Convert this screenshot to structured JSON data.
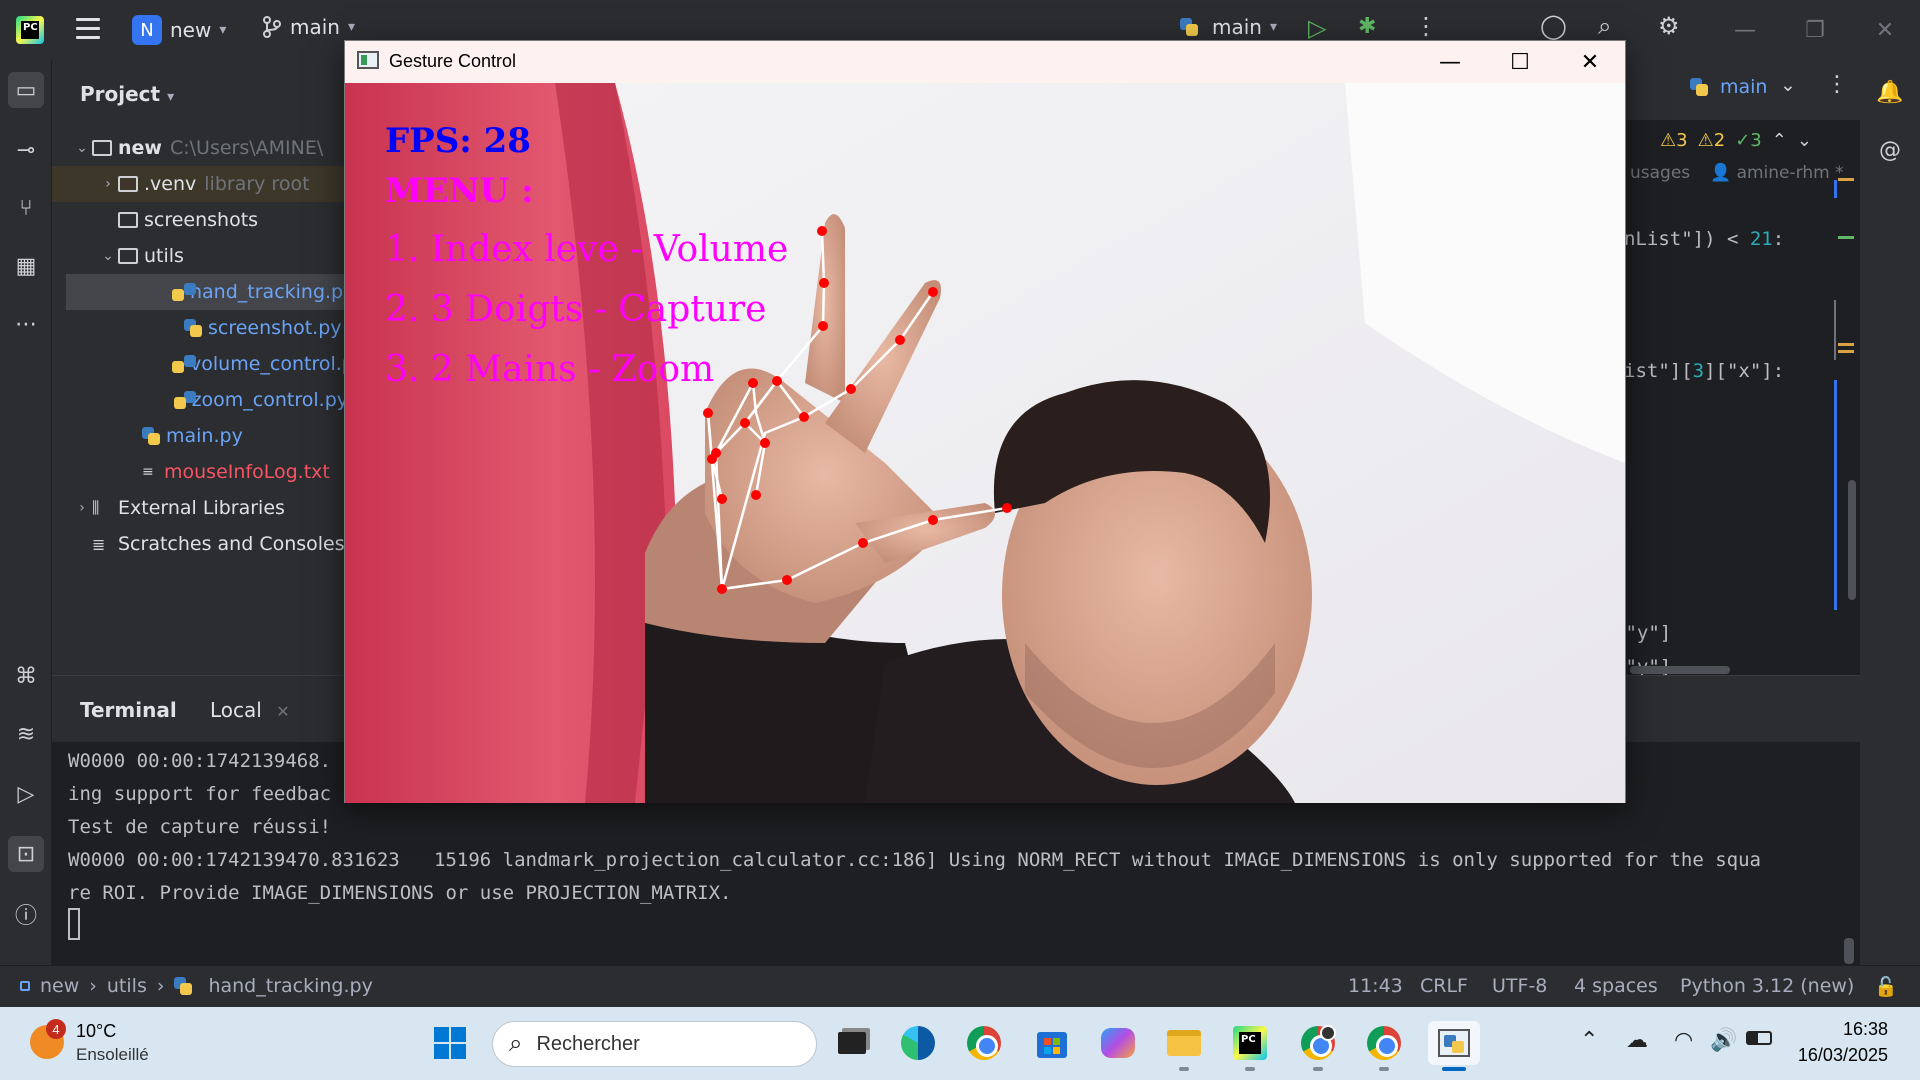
{
  "ide": {
    "project_badge": "N",
    "project_name": "new",
    "branch": "main",
    "run_config": "main",
    "editor_tab": "main"
  },
  "project_panel": {
    "title": "Project",
    "root_name": "new",
    "root_path": "C:\\Users\\AMINE\\",
    "items": [
      {
        "label": ".venv",
        "hint": "library root"
      },
      {
        "label": "screenshots"
      },
      {
        "label": "utils"
      },
      {
        "label": "hand_tracking.py"
      },
      {
        "label": "screenshot.py"
      },
      {
        "label": "volume_control.py"
      },
      {
        "label": "zoom_control.py"
      },
      {
        "label": "main.py"
      },
      {
        "label": "mouseInfoLog.txt"
      },
      {
        "label": "External Libraries"
      },
      {
        "label": "Scratches and Consoles"
      }
    ]
  },
  "editor": {
    "inspections": {
      "warnings_a": "3",
      "warnings_b": "2",
      "ok": "3"
    },
    "usages": "usages",
    "author": "amine-rhm *",
    "code_lines": [
      {
        "pre": "nList\"]) < ",
        "num": "21",
        "post": ":"
      },
      {
        "pre": "ist\"][",
        "num": "3",
        "post": "][\"x\"]:"
      },
      {
        "pre": "[\"y\"]"
      },
      {
        "pre": "[\"y\"]"
      }
    ]
  },
  "terminal": {
    "title": "Terminal",
    "tab": "Local",
    "lines": [
      "W0000 00:00:1742139468.                                                                       inference. Disabl",
      "ing support for feedbac",
      "Test de capture réussi!",
      "W0000 00:00:1742139470.831623   15196 landmark_projection_calculator.cc:186] Using NORM_RECT without IMAGE_DIMENSIONS is only supported for the squa",
      "re ROI. Provide IMAGE_DIMENSIONS or use PROJECTION_MATRIX."
    ]
  },
  "statusbar": {
    "crumbs": [
      "new",
      "utils",
      "hand_tracking.py"
    ],
    "position": "11:43",
    "line_sep": "CRLF",
    "encoding": "UTF-8",
    "indent": "4 spaces",
    "interpreter": "Python 3.12 (new)"
  },
  "gesture_window": {
    "title": "Gesture Control",
    "fps": "FPS: 28",
    "menu_title": "MENU :",
    "menu_items": [
      "1. Index leve - Volume",
      "2. 3 Doigts - Capture",
      "3. 2 Mains - Zoom"
    ],
    "colors": {
      "fps": "#0000ff",
      "menu": "#ff00ff",
      "landmark": "#ff0000"
    }
  },
  "taskbar": {
    "weather_temp": "10°C",
    "weather_desc": "Ensoleillé",
    "weather_badge": "4",
    "search_placeholder": "Rechercher",
    "time": "16:38",
    "date": "16/03/2025"
  }
}
